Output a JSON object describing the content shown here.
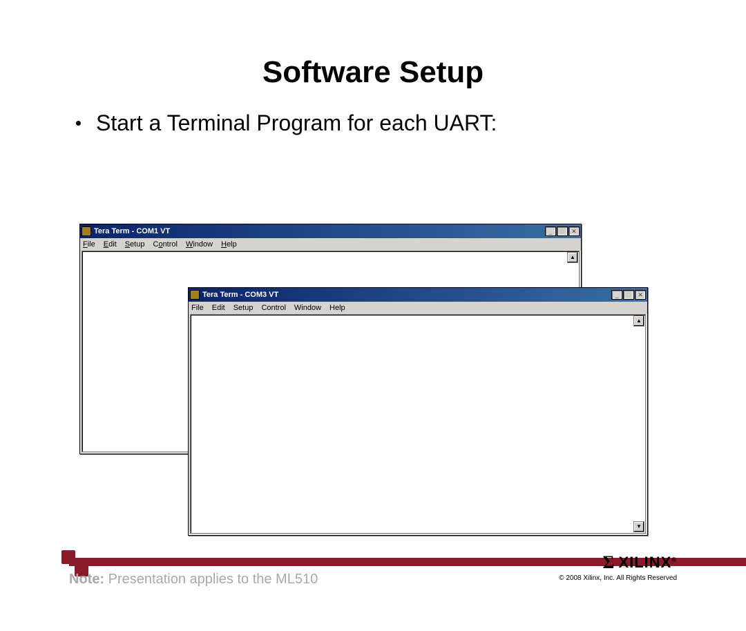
{
  "title": "Software Setup",
  "bullet": "Start a Terminal Program for each UART:",
  "windows": [
    {
      "title": "Tera Term - COM1 VT",
      "menus": [
        "File",
        "Edit",
        "Setup",
        "Control",
        "Window",
        "Help"
      ]
    },
    {
      "title": "Tera Term - COM3 VT",
      "menus": [
        "File",
        "Edit",
        "Setup",
        "Control",
        "Window",
        "Help"
      ]
    }
  ],
  "note_label": "Note:",
  "note_text": " Presentation applies to the ML510",
  "logo_text": "XILINX",
  "copyright": "© 2008 Xilinx, Inc. All Rights Reserved"
}
